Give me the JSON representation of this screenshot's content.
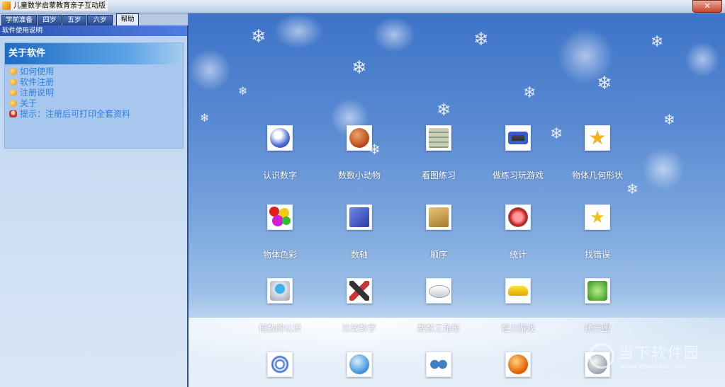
{
  "window": {
    "title": "儿童数学启蒙教育亲子互动版",
    "close_label": "✕"
  },
  "tabs": [
    {
      "label": "学前准备"
    },
    {
      "label": "四岁"
    },
    {
      "label": "五岁"
    },
    {
      "label": "六岁"
    },
    {
      "label": "帮助",
      "active": true
    }
  ],
  "panel": {
    "header": "软件使用说明",
    "section_title": "关于软件",
    "items": [
      {
        "label": "如何使用",
        "icon": "help-icon"
      },
      {
        "label": "软件注册",
        "icon": "register-icon"
      },
      {
        "label": "注册说明",
        "icon": "info-icon"
      },
      {
        "label": "关于",
        "icon": "about-icon"
      },
      {
        "label": "提示：注册后可打印全套资料",
        "icon": "person-icon"
      }
    ]
  },
  "grid": {
    "rows": [
      [
        {
          "label": "认识数字",
          "icon": "phone-dial-icon"
        },
        {
          "label": "数数小动物",
          "icon": "animal-icon"
        },
        {
          "label": "看图练习",
          "icon": "calculator-icon"
        },
        {
          "label": "做练习玩游戏",
          "icon": "gameboy-icon"
        },
        {
          "label": "物体几何形状",
          "icon": "star-icon"
        }
      ],
      [
        {
          "label": "物体色彩",
          "icon": "color-balls-icon"
        },
        {
          "label": "数轴",
          "icon": "blue-book-icon"
        },
        {
          "label": "顺序",
          "icon": "box-icon"
        },
        {
          "label": "统计",
          "icon": "red-button-icon"
        },
        {
          "label": "找错误",
          "icon": "star-frame-icon"
        }
      ],
      [
        {
          "label": "倍数的认识",
          "icon": "hard-drive-icon"
        },
        {
          "label": "比较数字",
          "icon": "tools-icon"
        },
        {
          "label": "数数三角形",
          "icon": "mouse-icon"
        },
        {
          "label": "智力游戏",
          "icon": "car-icon"
        },
        {
          "label": "统计图",
          "icon": "k-logo-icon"
        }
      ],
      [
        {
          "label": "",
          "icon": "swirl-icon"
        },
        {
          "label": "",
          "icon": "globe-icon"
        },
        {
          "label": "",
          "icon": "glasses-icon"
        },
        {
          "label": "",
          "icon": "number-ball-icon"
        },
        {
          "label": "",
          "icon": "bird-icon"
        }
      ]
    ]
  },
  "watermark": {
    "title": "当下软件园",
    "url": "www.downxia.com"
  }
}
